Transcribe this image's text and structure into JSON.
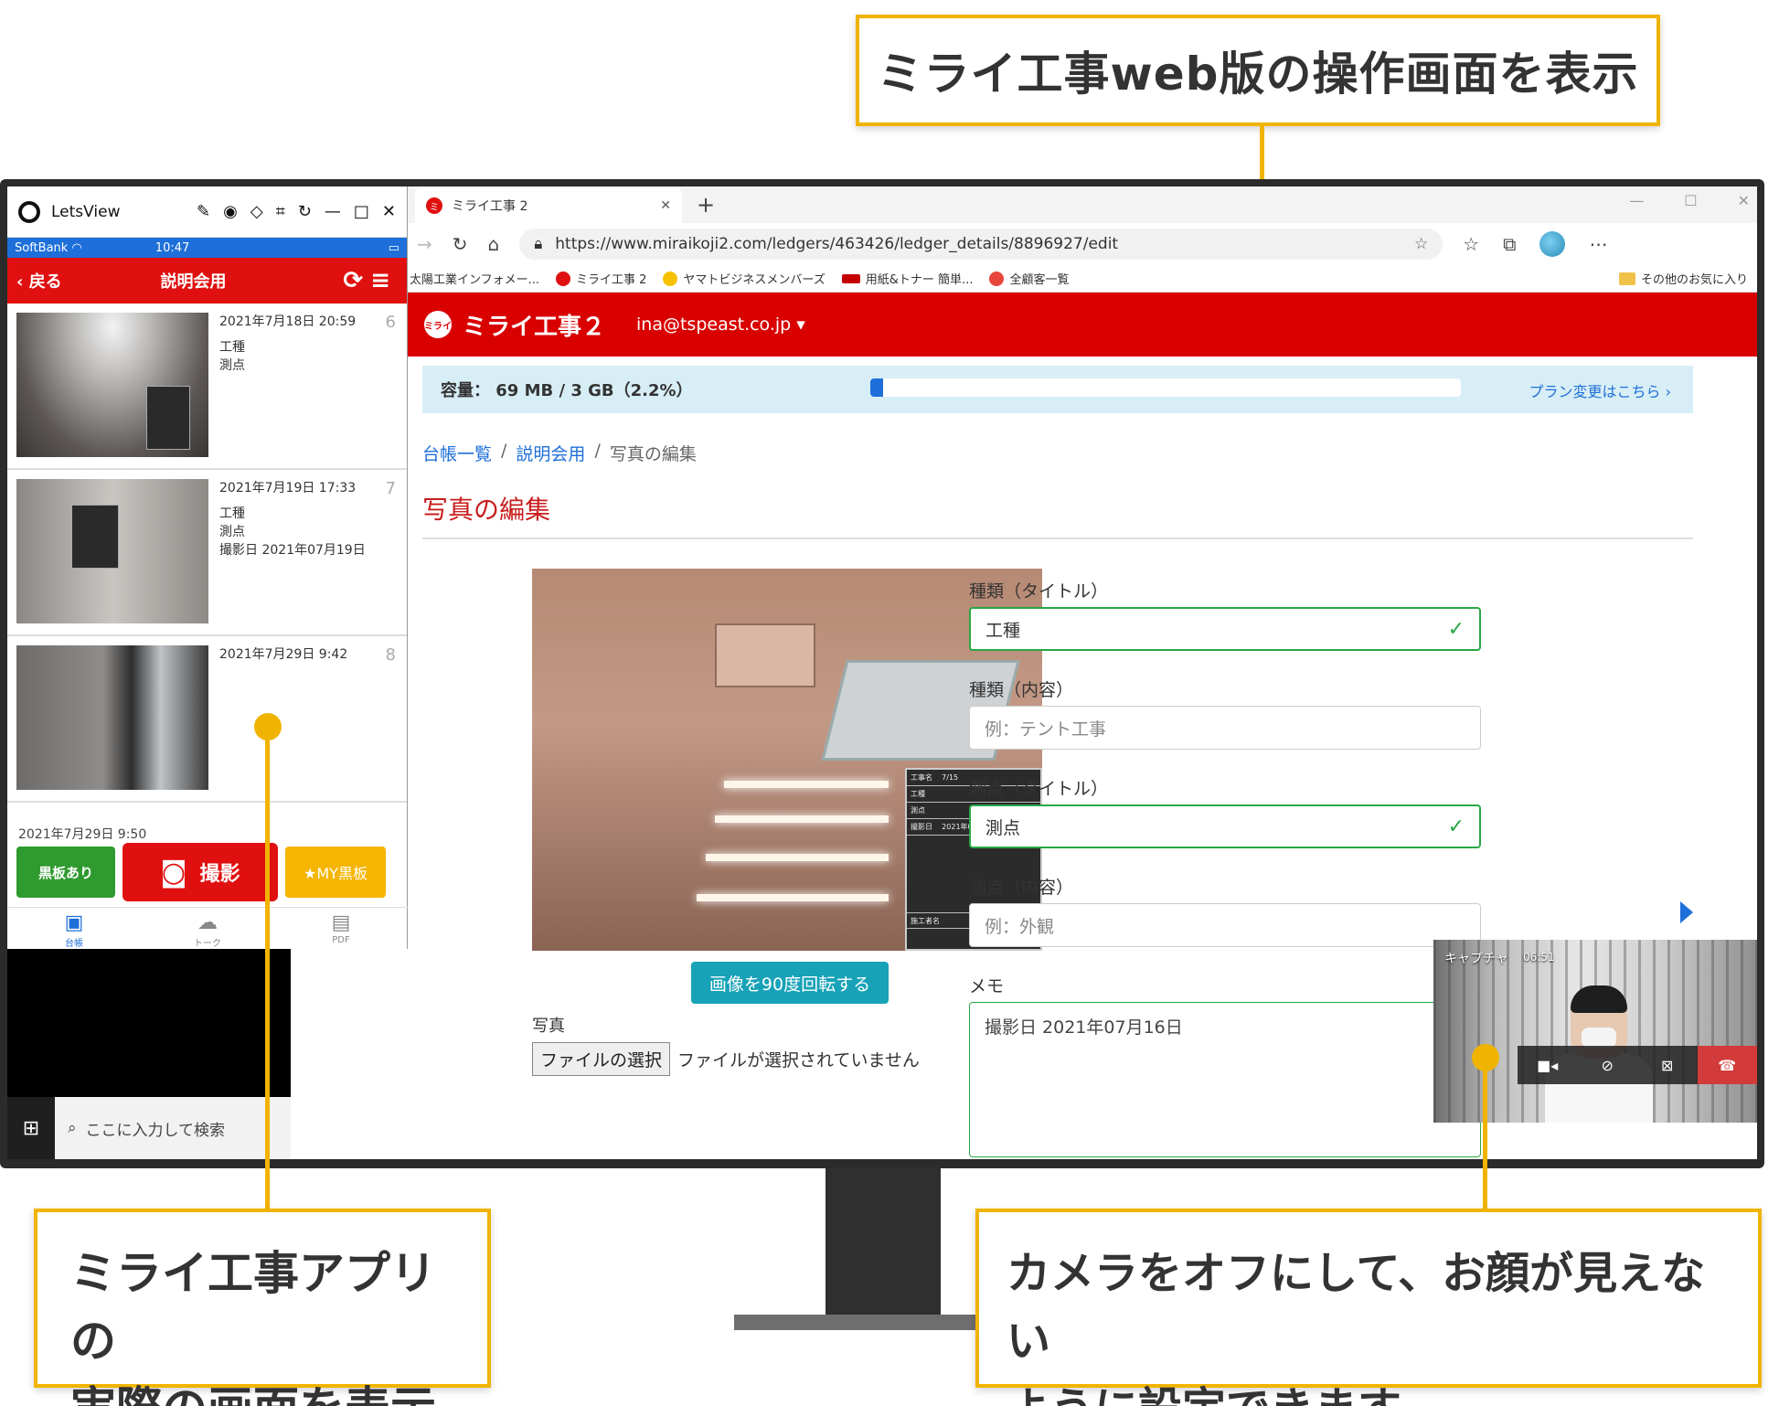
{
  "callouts": {
    "top": "ミライ工事web版の操作画面を表示",
    "left_line1": "ミライ工事アプリの",
    "left_line2": "実際の画面を表示",
    "right_line1": "カメラをオフにして、お顔が見えない",
    "right_line2": "ように設定できます。"
  },
  "letsview": {
    "title": "LetsView",
    "status": {
      "carrier": "SoftBank",
      "time": "10:47"
    },
    "header": {
      "back": "戻る",
      "title": "説明会用"
    },
    "items": [
      {
        "date": "2021年7月18日 20:59",
        "line1": "工種",
        "line2": "測点",
        "line3": "",
        "num": "6"
      },
      {
        "date": "2021年7月19日 17:33",
        "line1": "工種",
        "line2": "測点",
        "line3": "撮影日 2021年07月19日",
        "num": "7"
      },
      {
        "date": "2021年7月29日 9:42",
        "line1": "",
        "line2": "",
        "line3": "",
        "num": "8"
      }
    ],
    "partial_row": "2021年7月29日 9:50",
    "buttons": {
      "board": "黒板あり",
      "shoot": "撮影",
      "my_board": "★MY黒板"
    },
    "tabs": [
      "台帳",
      "トーク",
      "PDF"
    ],
    "search_placeholder": "ここに入力して検索"
  },
  "browser": {
    "tab_title": "ミライ工事 2",
    "url": "https://www.miraikoji2.com/ledgers/463426/ledger_details/8896927/edit",
    "bookmarks": [
      "太陽工業インフォメー...",
      "ミライ工事 2",
      "ヤマトビジネスメンバーズ",
      "用紙&トナー 簡単...",
      "全顧客一覧"
    ],
    "bookmarks_other": "その他のお気に入り"
  },
  "site": {
    "name": "ミライ工事２",
    "user": "ina@tspeast.co.jp ▾",
    "capacity_text": "容量： 69 MB / 3 GB（2.2%）",
    "capacity_fraction": 0.022,
    "plan_link": "プラン変更はこちら ›",
    "breadcrumb": [
      "台帳一覧",
      "説明会用",
      "写真の編集"
    ],
    "page_title": "写真の編集",
    "rotate_button": "画像を90度回転する",
    "photo_label": "写真",
    "file_button": "ファイルの選択",
    "file_status": "ファイルが選択されていません",
    "board_rows": [
      "工事名",
      "工種",
      "測点",
      "撮影日",
      "",
      "",
      "",
      "施工者名"
    ],
    "board_values": [
      "7/15",
      "",
      "",
      "2021年07月16日"
    ]
  },
  "form": {
    "kind_title_label": "種類（タイトル）",
    "kind_title_value": "工種",
    "kind_content_label": "種類（内容）",
    "kind_content_placeholder": "例：テント工事",
    "point_title_label": "測点（タイトル）",
    "point_title_value": "測点",
    "point_content_label": "測点（内容）",
    "point_content_placeholder": "例：外観",
    "memo_label": "メモ",
    "memo_value": "撮影日 2021年07月16日"
  },
  "video": {
    "title": "キャプチャ",
    "time": "06:51"
  }
}
